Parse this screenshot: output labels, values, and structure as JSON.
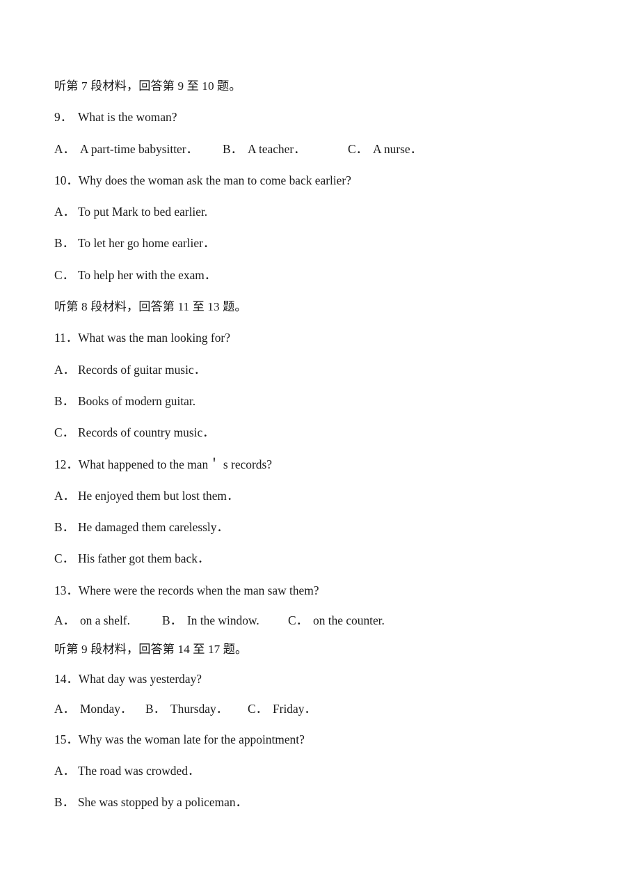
{
  "document": {
    "type": "listening-comprehension-worksheet",
    "background_color": "#ffffff",
    "text_color": "#1a1a1a"
  },
  "sections": [
    {
      "header": "听第 7 段材料，回答第 9 至 10 题。",
      "questions": [
        {
          "number": "9．",
          "text": "What is the woman?",
          "layout": "inline",
          "options": [
            {
              "label": "A．",
              "text": "A part-time babysitter．"
            },
            {
              "label": "B．",
              "text": "A teacher．"
            },
            {
              "label": "C．",
              "text": "A nurse．"
            }
          ]
        },
        {
          "number": "10．",
          "text": "Why does the woman ask the man to come back earlier?",
          "layout": "stacked",
          "options": [
            {
              "label": "A．",
              "text": "To put Mark to bed earlier."
            },
            {
              "label": "B．",
              "text": "To let her go home earlier．"
            },
            {
              "label": "C．",
              "text": "To help her with the exam．"
            }
          ]
        }
      ]
    },
    {
      "header": "听第 8 段材料，回答第 11 至 13 题。",
      "questions": [
        {
          "number": "11．",
          "text": "What was the man looking for?",
          "layout": "stacked",
          "options": [
            {
              "label": "A．",
              "text": "Records of guitar music．"
            },
            {
              "label": "B．",
              "text": "Books of modern guitar."
            },
            {
              "label": "C．",
              "text": "Records of country music．"
            }
          ]
        },
        {
          "number": "12．",
          "text": "What happened to the man＇ s records?",
          "layout": "stacked",
          "options": [
            {
              "label": "A．",
              "text": "He enjoyed them but lost them．"
            },
            {
              "label": "B．",
              "text": "He damaged them carelessly．"
            },
            {
              "label": "C．",
              "text": "His father got them back．"
            }
          ]
        },
        {
          "number": "13．",
          "text": "Where were the records when the man saw them?",
          "layout": "inline",
          "options": [
            {
              "label": "A．",
              "text": "on a shelf."
            },
            {
              "label": "B．",
              "text": "In the window."
            },
            {
              "label": "C．",
              "text": "on the counter."
            }
          ]
        }
      ]
    },
    {
      "header": "听第 9 段材料，回答第 14 至 17 题。",
      "questions": [
        {
          "number": "14．",
          "text": "What day was yesterday?",
          "layout": "inline",
          "options": [
            {
              "label": "A．",
              "text": "Monday．"
            },
            {
              "label": "B．",
              "text": "Thursday．"
            },
            {
              "label": "C．",
              "text": "Friday．"
            }
          ]
        },
        {
          "number": "15．",
          "text": "Why was the woman late for the appointment?",
          "layout": "stacked",
          "options": [
            {
              "label": "A．",
              "text": "The road was crowded．"
            },
            {
              "label": "B．",
              "text": "She was stopped by a policeman．"
            }
          ]
        }
      ]
    }
  ],
  "column_offsets": {
    "q9": [
      "0px",
      "242px",
      "422px"
    ],
    "q13": [
      "0px",
      "155px",
      "336px"
    ],
    "q14": [
      "0px",
      "131px",
      "278px"
    ]
  }
}
